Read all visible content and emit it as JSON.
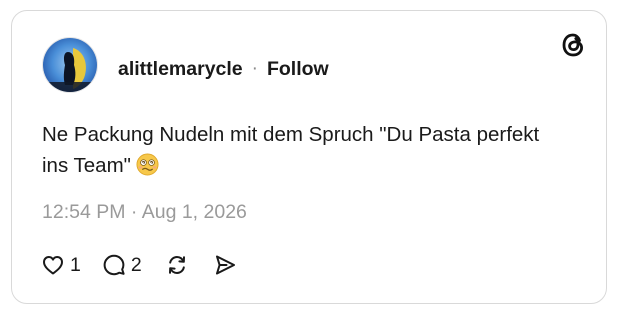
{
  "post": {
    "username": "alittlemarycle",
    "separator": "·",
    "follow_label": "Follow",
    "text": "Ne Packung Nudeln mit dem Spruch \"Du Pasta perfekt ins Team\"",
    "emoji": "woozy-face",
    "timestamp": "12:54 PM · Aug 1, 2026",
    "likes": "1",
    "replies": "2"
  },
  "icons": {
    "logo": "threads-logo-icon",
    "like": "heart-icon",
    "reply": "speech-bubble-icon",
    "repost": "repost-icon",
    "share": "send-icon"
  },
  "colors": {
    "text": "#1a1a1a",
    "muted": "#9a9a9a",
    "border": "#d9d9d9",
    "emoji": "#f7c84a"
  }
}
